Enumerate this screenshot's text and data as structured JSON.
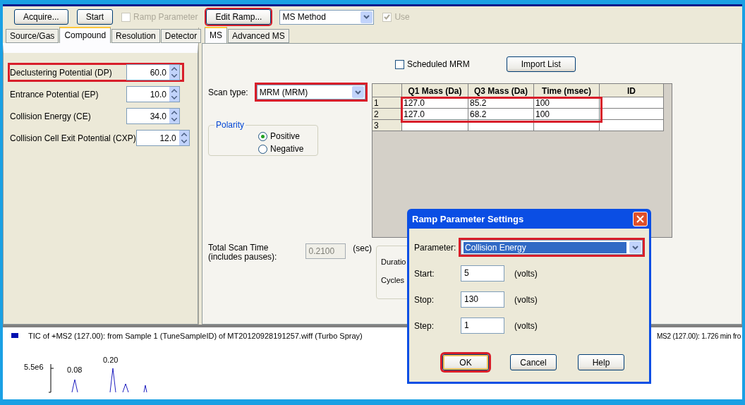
{
  "toolbar": [
    {
      "kind": "button",
      "label": "Acquire...",
      "highlighted": false
    },
    {
      "kind": "button",
      "label": "Start",
      "highlighted": false
    },
    {
      "kind": "checkbox",
      "label": "Ramp Parameter",
      "checked": false,
      "disabled": true
    },
    {
      "kind": "button",
      "label": "Edit Ramp...",
      "highlighted": true
    },
    {
      "kind": "select",
      "value": "MS Method"
    },
    {
      "kind": "checkbox",
      "label": "Use",
      "checked": true,
      "disabled": true
    }
  ],
  "left_tabs": [
    {
      "label": "Source/Gas",
      "selected": false
    },
    {
      "label": "Compound",
      "selected": true
    },
    {
      "label": "Resolution",
      "selected": false
    },
    {
      "label": "Detector",
      "selected": false
    }
  ],
  "compound_params": [
    {
      "label": "Declustering Potential (DP)",
      "value": "60.0",
      "highlighted": true
    },
    {
      "label": "Entrance Potential (EP)",
      "value": "10.0",
      "highlighted": false
    },
    {
      "label": "Collision Energy (CE)",
      "value": "34.0",
      "highlighted": false
    },
    {
      "label": "Collision Cell Exit Potential (CXP)",
      "value": "12.0",
      "highlighted": false
    }
  ],
  "ms_tabs": [
    {
      "label": "MS",
      "selected": true
    },
    {
      "label": "Advanced MS",
      "selected": false
    }
  ],
  "scheduled_mrm": {
    "label": "Scheduled MRM",
    "checked": false
  },
  "import_list": {
    "label": "Import List"
  },
  "scan_type": {
    "label": "Scan type:",
    "value": "MRM (MRM)",
    "highlighted": true
  },
  "polarity": {
    "title": "Polarity",
    "options": [
      {
        "label": "Positive",
        "selected": true
      },
      {
        "label": "Negative",
        "selected": false
      }
    ]
  },
  "table": {
    "columns": [
      "Q1 Mass (Da)",
      "Q3 Mass (Da)",
      "Time (msec)",
      "ID"
    ],
    "rows": [
      {
        "number": "1",
        "q1": "127.0",
        "q3": "85.2",
        "time": "100",
        "highlighted": true
      },
      {
        "number": "2",
        "q1": "127.0",
        "q3": "68.2",
        "time": "100",
        "highlighted": true
      },
      {
        "number": "3",
        "highlighted": false
      }
    ]
  },
  "total_scan_time": {
    "label": "Total Scan Time (includes pauses):",
    "value": "0.2100",
    "unit": "(sec)",
    "disabled": true
  },
  "cycle_group": {
    "labels": [
      "Duratio",
      "Cycles"
    ]
  },
  "chart": {
    "title": "TIC of +MS2 (127.00): from Sample 1 (TuneSampleID) of MT20120928191257.wiff (Turbo Spray)",
    "y_tick": "5.5e6",
    "peak_labels": [
      "0.08",
      "0.20"
    ],
    "right_title": "MS2 (127.00): 1.726 min fro"
  },
  "dialog": {
    "title": "Ramp Parameter Settings",
    "parameter": {
      "label": "Parameter:",
      "value": "Collision Energy",
      "highlighted": true
    },
    "fields": [
      {
        "label": "Start:",
        "value": "5",
        "unit": "(volts)"
      },
      {
        "label": "Stop:",
        "value": "130",
        "unit": "(volts)"
      },
      {
        "label": "Step:",
        "value": "1",
        "unit": "(volts)"
      }
    ],
    "buttons": [
      {
        "label": "OK",
        "highlighted": true
      },
      {
        "label": "Cancel",
        "highlighted": false
      },
      {
        "label": "Help",
        "highlighted": false
      }
    ]
  }
}
